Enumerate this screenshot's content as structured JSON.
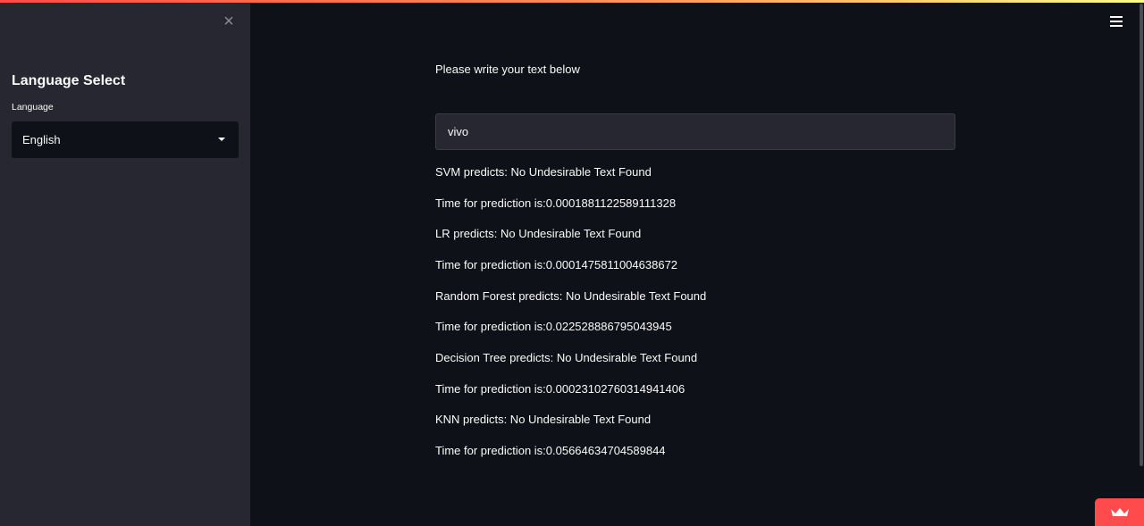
{
  "sidebar": {
    "close_label": "×",
    "title": "Language Select",
    "select_label": "Language",
    "select_value": "English"
  },
  "main": {
    "prompt": "Please write your text below",
    "input_value": "vivo",
    "results": [
      "SVM predicts: No Undesirable Text Found",
      "Time for prediction is:0.0001881122589111328",
      "LR predicts: No Undesirable Text Found",
      "Time for prediction is:0.0001475811004638672",
      "Random Forest predicts: No Undesirable Text Found",
      "Time for prediction is:0.022528886795043945",
      "Decision Tree predicts: No Undesirable Text Found",
      "Time for prediction is:0.00023102760314941406",
      "KNN predicts: No Undesirable Text Found",
      "Time for prediction is:0.05664634704589844"
    ]
  },
  "colors": {
    "background": "#0e1117",
    "sidebar": "#262730",
    "accent": "#ff4b4b"
  },
  "icons": {
    "close": "close-icon",
    "menu": "hamburger-menu-icon",
    "caret": "chevron-down-icon",
    "badge": "crown-icon"
  }
}
